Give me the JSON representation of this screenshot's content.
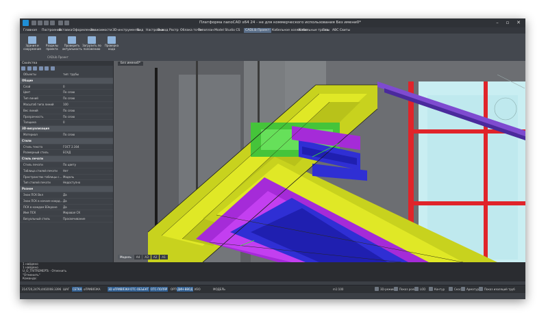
{
  "app": {
    "title": "Платформа nanoCAD x64 24 - не для коммерческого использования Без имени0*",
    "window_buttons": [
      "–",
      "▫",
      "✕"
    ],
    "colors": {
      "accent": "#2f5d8f",
      "tab_active": "#5a6f8a",
      "viewport_bg": "#6d6f73"
    }
  },
  "menu": {
    "items": [
      "Главная",
      "Построение",
      "Вставка",
      "Оформление",
      "Зависимости",
      "3D-инструменты",
      "Вид",
      "Настройки",
      "Вывод",
      "Растр",
      "Облака точек",
      "Топоплан",
      "Model Studio CS",
      "CADLib Проект",
      "Кабельное хозяйство",
      "Кабельные трассы",
      "Гео",
      "ABC Свиты"
    ],
    "active_index": 13
  },
  "ribbon": {
    "buttons": [
      {
        "label": "Здания и сооружения",
        "icon": "building-icon"
      },
      {
        "label": "Разделы проекта",
        "icon": "sections-icon"
      },
      {
        "label": "Проверить актуальность",
        "icon": "check-icon"
      },
      {
        "label": "Загрузить по положению",
        "icon": "download-icon"
      },
      {
        "label": "Проверка кода",
        "icon": "code-check-icon"
      }
    ],
    "group_label": "CADLib Проект"
  },
  "properties": {
    "title": "Свойства",
    "object_key": "Объекты",
    "object_value": "тип: трубы",
    "rows": [
      {
        "type": "section",
        "k": "Общие"
      },
      {
        "k": "Слой",
        "v": "0"
      },
      {
        "k": "Цвет",
        "v": "По слою"
      },
      {
        "k": "Тип линий",
        "v": "По слою"
      },
      {
        "k": "Масштаб типа линий",
        "v": "100"
      },
      {
        "k": "Вес линий",
        "v": "По слою"
      },
      {
        "k": "Прозрачность",
        "v": "По слою"
      },
      {
        "k": "Толщина",
        "v": "0"
      },
      {
        "type": "section",
        "k": "3D-визуализация"
      },
      {
        "k": "Материал",
        "v": "По слою"
      },
      {
        "type": "section",
        "k": "Стили"
      },
      {
        "k": "Стиль текста",
        "v": "ГОСТ 2.304"
      },
      {
        "k": "Размерный стиль",
        "v": "ЕСКД"
      },
      {
        "type": "section",
        "k": "Стиль печати"
      },
      {
        "k": "Стиль печати",
        "v": "По цвету"
      },
      {
        "k": "Таблица стилей печати",
        "v": "Нет"
      },
      {
        "k": "Пространство таблицы с...",
        "v": "Модель"
      },
      {
        "k": "Тип стилей печати",
        "v": "Недоступно"
      },
      {
        "type": "section",
        "k": "Разное"
      },
      {
        "k": "Знак ПСК Вкл",
        "v": "Да"
      },
      {
        "k": "Знак ПСК в начале коорд...",
        "v": "Да"
      },
      {
        "k": "ПСК в каждом ВЭкране",
        "v": "Да"
      },
      {
        "k": "Имя ПСК",
        "v": "Мировая СК"
      },
      {
        "k": "Визуальный стиль",
        "v": "Просвечивание"
      }
    ],
    "tabs": [
      "Свойства",
      "Команды",
      "Редактирование",
      "Model Studio CS"
    ]
  },
  "viewport": {
    "doc_tab": "Без имени0*",
    "layout_tabs": [
      "Модель",
      "A4",
      "A3",
      "A2",
      "A1"
    ]
  },
  "command_line": [
    "1 найдено",
    "1 найдено",
    "U_O_TRITREMEPTs - Отменить",
    "\"Отменить\"",
    "Команда:"
  ],
  "status": {
    "coords": "214720,2479,4402008.3396",
    "toggles": [
      {
        "label": "ШАГ",
        "on": false
      },
      {
        "label": "СЕТКА",
        "on": true
      },
      {
        "label": "оПРИВЯЗКА",
        "on": false
      },
      {
        "label": "3D оПРИВЯЗКА",
        "on": true
      },
      {
        "label": "ОТС-ОБЪЕКТ",
        "on": true
      },
      {
        "label": "ОТС-ПОЛЯР",
        "on": true
      },
      {
        "label": "ОРТО",
        "on": false
      },
      {
        "label": "ДИН-ВВОД",
        "on": true
      },
      {
        "label": "ИЗО",
        "on": false
      },
      {
        "label": "МОДЕЛЬ",
        "on": false
      }
    ],
    "scale": "m1:100",
    "right_items": [
      "3D-режим",
      "Показ ролов",
      "LOD",
      "Контур",
      "Скос",
      "Арматура",
      "Показ изоляций труб"
    ]
  }
}
